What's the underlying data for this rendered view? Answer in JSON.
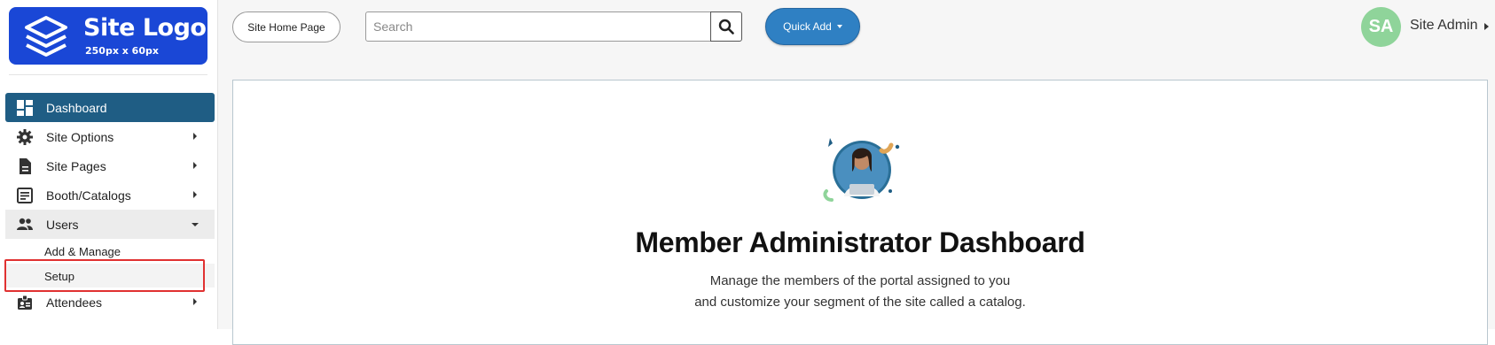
{
  "logo": {
    "title": "Site Logo",
    "subtitle": "250px x 60px",
    "bg_color": "#1a47d6"
  },
  "sidebar": {
    "items": [
      {
        "label": "Dashboard",
        "icon": "dashboard-icon",
        "state": "active"
      },
      {
        "label": "Site Options",
        "icon": "gear-icon"
      },
      {
        "label": "Site Pages",
        "icon": "document-icon"
      },
      {
        "label": "Booth/Catalogs",
        "icon": "catalog-icon"
      },
      {
        "label": "Users",
        "icon": "users-icon",
        "state": "expanded"
      },
      {
        "label": "Attendees",
        "icon": "badge-icon"
      }
    ],
    "users_sub": [
      {
        "label": "Add & Manage"
      },
      {
        "label": "Setup",
        "state": "selected"
      }
    ]
  },
  "topbar": {
    "home_label": "Site Home Page",
    "search_placeholder": "Search",
    "quick_add_label": "Quick Add",
    "avatar_initials": "SA",
    "user_name": "Site Admin"
  },
  "main": {
    "title": "Member Administrator Dashboard",
    "desc_line1": "Manage the members of the portal assigned to you",
    "desc_line2": "and customize your segment of the site called a catalog."
  },
  "colors": {
    "active_nav": "#1f5d84",
    "quick_add": "#2f80c3",
    "avatar": "#8fd49a",
    "highlight": "#e03131"
  }
}
